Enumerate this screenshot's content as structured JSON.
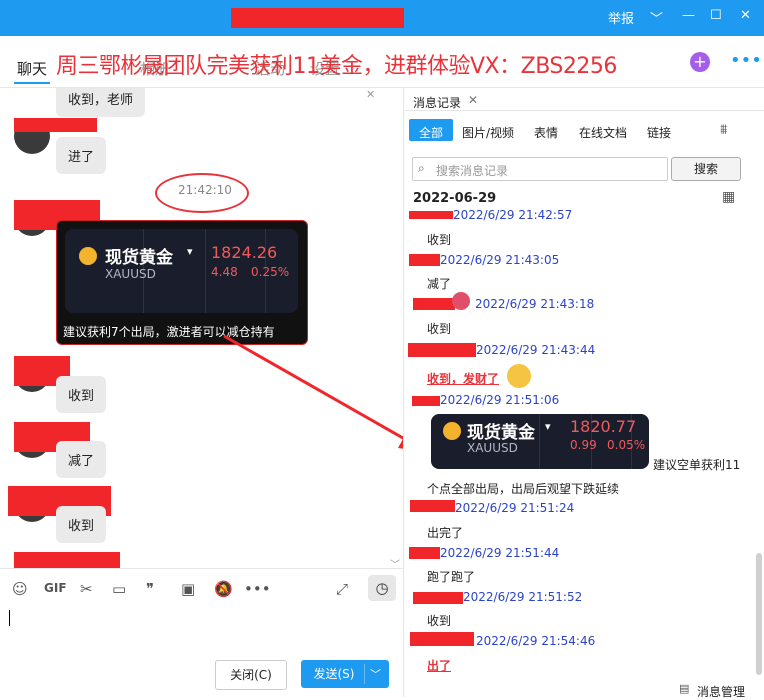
{
  "nav": {
    "tabs": [
      "聊天",
      "公告",
      "相册",
      "文件",
      "活动",
      "设置"
    ],
    "overlay_text": "周三鄂彬晟团队完美获利11美金，进群体验VX：ZBS2256"
  },
  "titlebar": {
    "report": "举报"
  },
  "chat": {
    "msg1": "收到，老师",
    "msg2": "进了",
    "time": "21:42:10",
    "card": {
      "name": "现货黄金",
      "symbol": "XAUUSD",
      "price": "1824.26",
      "change": "4.48",
      "pct": "0.25%"
    },
    "card_caption": "建议获利7个出局，激进者可以减仓持有",
    "msg3": "收到",
    "msg4": "减了",
    "msg5": "收到"
  },
  "toolbar": {
    "gif": "GIF"
  },
  "buttons": {
    "close": "关闭(C)",
    "send": "发送(S)"
  },
  "history": {
    "title": "消息记录",
    "tabs": [
      "全部",
      "图片/视频",
      "表情",
      "在线文档",
      "链接"
    ],
    "search_placeholder": "搜索消息记录",
    "search_button": "搜索",
    "date": "2022-06-29",
    "entries": [
      {
        "time": "2022/6/29 21:42:57",
        "text": "收到"
      },
      {
        "time": "2022/6/29 21:43:05",
        "text": "减了"
      },
      {
        "time": "2022/6/29 21:43:18",
        "text": "收到"
      },
      {
        "time": "2022/6/29 21:43:44",
        "text": "收到，发财了"
      },
      {
        "time": "2022/6/29 21:51:06",
        "text": "建议空单获利11个点全部出局，出局后观望下跌延续"
      },
      {
        "time": "2022/6/29 21:51:24",
        "text": "出完了"
      },
      {
        "time": "2022/6/29 21:51:44",
        "text": "跑了跑了"
      },
      {
        "time": "2022/6/29 21:51:52",
        "text": "收到"
      },
      {
        "time": "2022/6/29 21:54:46",
        "text": "出了"
      }
    ],
    "card": {
      "name": "现货黄金",
      "symbol": "XAUUSD",
      "price": "1820.77",
      "change": "0.99",
      "pct": "0.05%"
    },
    "caption_line1": "建议空单获利11",
    "caption_line2": "个点全部出局，出局后观望下跌延续",
    "manage": "消息管理"
  }
}
